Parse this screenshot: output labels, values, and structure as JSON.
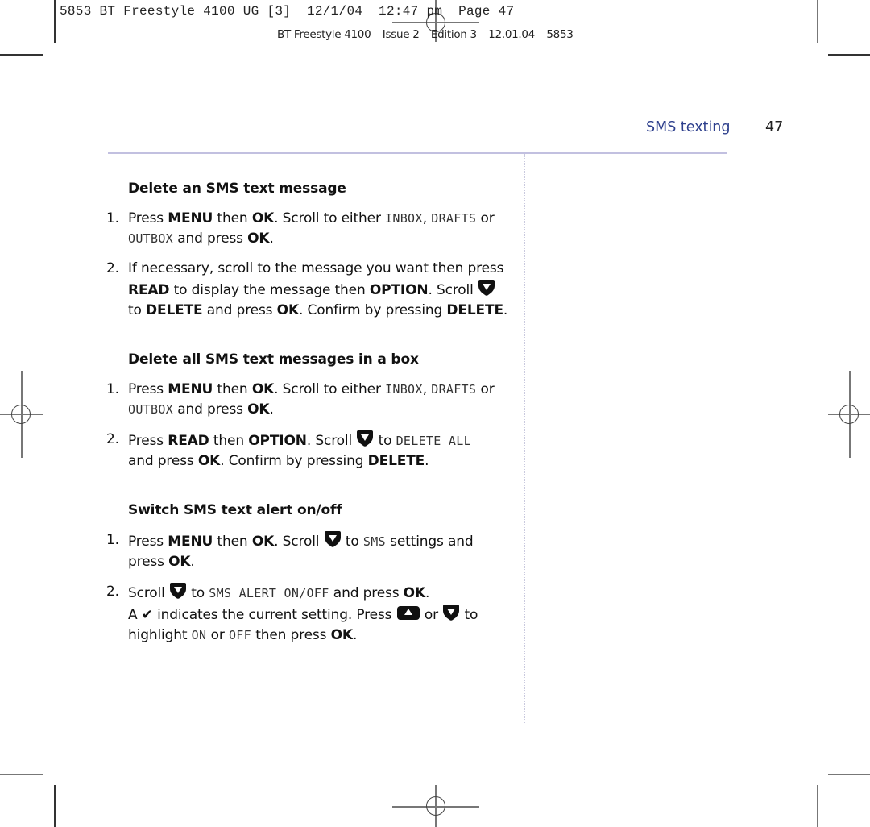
{
  "header": {
    "slug_line": "5853 BT Freestyle 4100 UG [3]  12/1/04  12:47 pm  Page 47",
    "edition_line": "BT Freestyle 4100 – Issue 2 – Edition 3 – 12.01.04 – 5853"
  },
  "running_head": {
    "section": "SMS texting",
    "page_number": "47"
  },
  "sections": [
    {
      "heading": "Delete an SMS text message",
      "steps": [
        {
          "num": "1.",
          "parts": [
            "Press ",
            "MENU",
            " then ",
            "OK",
            ". Scroll to either ",
            "INBOX",
            ", ",
            "DRAFTS",
            " or ",
            "OUTBOX",
            " and press ",
            "OK",
            "."
          ]
        },
        {
          "num": "2.",
          "parts": [
            "If necessary, scroll to the message you want then press ",
            "READ",
            " to display the message then ",
            "OPTION",
            ". Scroll ",
            " to ",
            "DELETE",
            " and press ",
            "OK",
            ". Confirm by pressing ",
            "DELETE",
            "."
          ]
        }
      ]
    },
    {
      "heading": "Delete all SMS text messages in a box",
      "steps": [
        {
          "num": "1.",
          "parts": [
            "Press ",
            "MENU",
            " then ",
            "OK",
            ". Scroll to either ",
            "INBOX",
            ", ",
            "DRAFTS",
            " or ",
            "OUTBOX",
            " and press ",
            "OK",
            "."
          ]
        },
        {
          "num": "2.",
          "parts": [
            "Press ",
            "READ",
            " then ",
            "OPTION",
            ". Scroll ",
            " to ",
            "DELETE ALL",
            " and press ",
            "OK",
            ". Confirm by pressing ",
            "DELETE",
            "."
          ]
        }
      ]
    },
    {
      "heading": "Switch SMS text alert on/off",
      "steps": [
        {
          "num": "1.",
          "parts": [
            "Press ",
            "MENU",
            " then ",
            "OK",
            ". Scroll ",
            " to ",
            "SMS",
            " settings and press ",
            "OK",
            "."
          ]
        },
        {
          "num": "2.",
          "parts": [
            "Scroll ",
            " to ",
            "SMS ALERT ON/OFF",
            " and press ",
            "OK",
            ".",
            "A ",
            "✔",
            " indicates the current setting. Press ",
            " or ",
            " to highlight ",
            "ON",
            " or ",
            "OFF",
            " then press ",
            "OK",
            "."
          ]
        }
      ]
    }
  ],
  "icons": {
    "scroll_down": "down-arrow-key-icon",
    "scroll_up": "up-arrow-key-icon",
    "check": "check-mark-icon"
  },
  "colors": {
    "accent": "#2c3e8c",
    "rule": "#c2c0e0"
  }
}
